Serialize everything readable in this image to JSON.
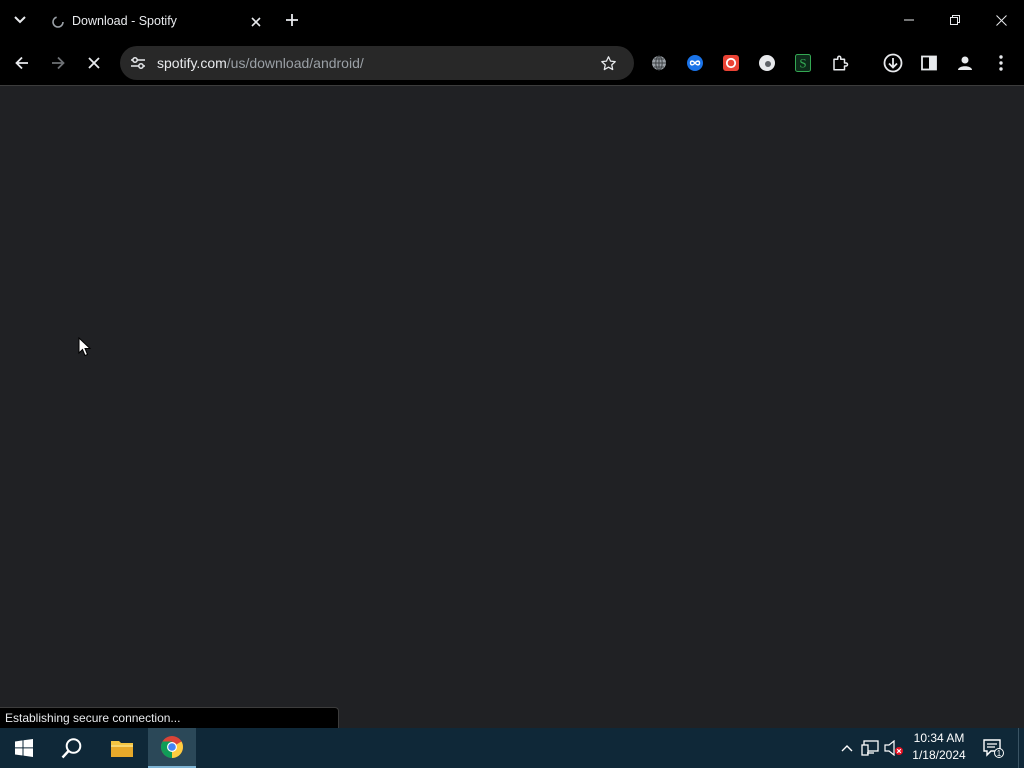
{
  "browser": {
    "tab": {
      "title": "Download - Spotify",
      "favicon": "loading-globe-icon"
    },
    "new_tab_label": "+",
    "address": {
      "host": "spotify.com",
      "path": "/us/download/android/"
    },
    "status_text": "Establishing secure connection..."
  },
  "extensions": [
    {
      "name": "globe-extension-icon",
      "color": "#9aa0a6"
    },
    {
      "name": "infinity-extension-icon",
      "color": "#1a73e8"
    },
    {
      "name": "red-circle-extension-icon",
      "color": "#ea4335"
    },
    {
      "name": "white-circle-extension-icon",
      "color": "#e8eaed"
    },
    {
      "name": "s-extension-icon",
      "color": "#34a853",
      "letter": "S"
    },
    {
      "name": "puzzle-extensions-icon",
      "color": "#e8eaed"
    }
  ],
  "taskbar": {
    "time": "10:34 AM",
    "date": "1/18/2024",
    "notification_count": "1"
  },
  "colors": {
    "chrome_bg": "#000000",
    "page_bg": "#202124",
    "taskbar_bg": "#0f2838"
  }
}
